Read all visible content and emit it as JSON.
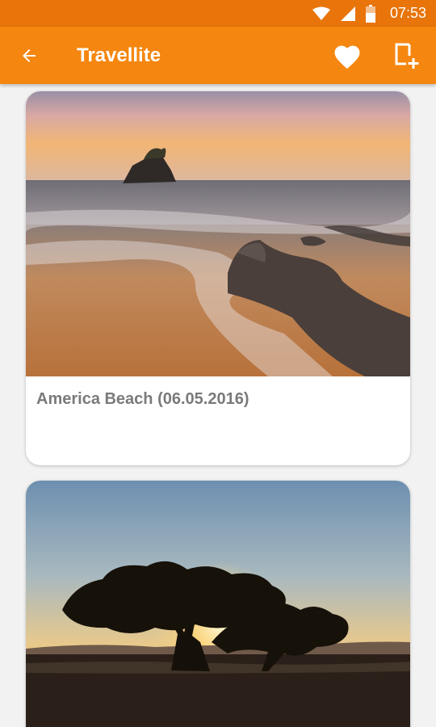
{
  "status_bar": {
    "time": "07:53",
    "icons": [
      "wifi-icon",
      "cell-signal-icon",
      "battery-icon"
    ]
  },
  "app_bar": {
    "title": "Travellite",
    "actions": [
      "back-arrow-icon",
      "heart-icon",
      "add-to-list-icon"
    ]
  },
  "cards": [
    {
      "caption": "America Beach (06.05.2016)"
    },
    {
      "caption": ""
    }
  ],
  "colors": {
    "status_bar": "#e8740a",
    "app_bar": "#f5860f",
    "background": "#f2f2f2",
    "caption_text": "#7a7a7a"
  }
}
